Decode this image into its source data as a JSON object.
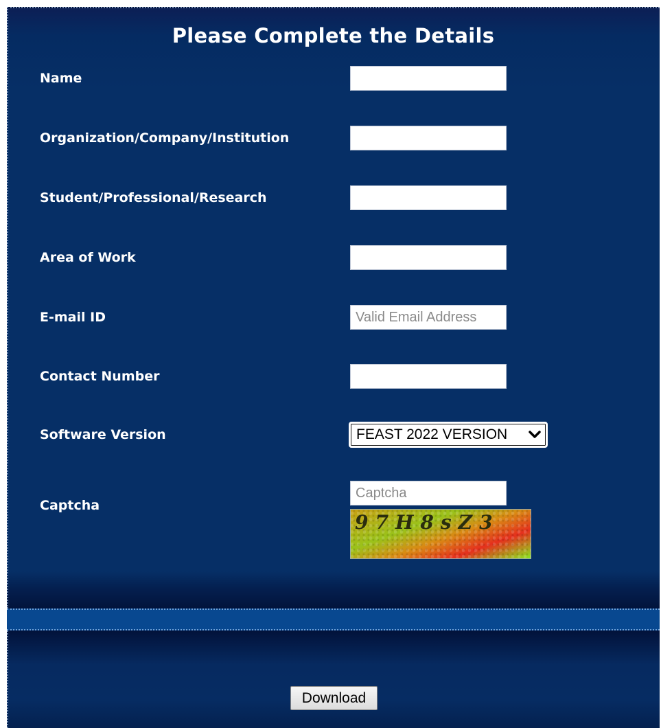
{
  "form": {
    "title": "Please Complete the Details",
    "fields": [
      {
        "label": "Name",
        "value": "",
        "placeholder": ""
      },
      {
        "label": "Organization/Company/Institution",
        "value": "",
        "placeholder": ""
      },
      {
        "label": "Student/Professional/Research",
        "value": "",
        "placeholder": ""
      },
      {
        "label": "Area of Work",
        "value": "",
        "placeholder": ""
      },
      {
        "label": "E-mail ID",
        "value": "",
        "placeholder": "Valid Email Address"
      },
      {
        "label": "Contact Number",
        "value": "",
        "placeholder": ""
      }
    ],
    "software_version": {
      "label": "Software Version",
      "selected": "FEAST 2022 VERSION",
      "icon": "chevron-down-icon"
    },
    "captcha": {
      "label": "Captcha",
      "placeholder": "Captcha",
      "image_text": "97H8sZ3"
    },
    "download_label": "Download"
  },
  "colors": {
    "panel": "#062f66",
    "band": "#084890",
    "text": "#ffffff"
  }
}
